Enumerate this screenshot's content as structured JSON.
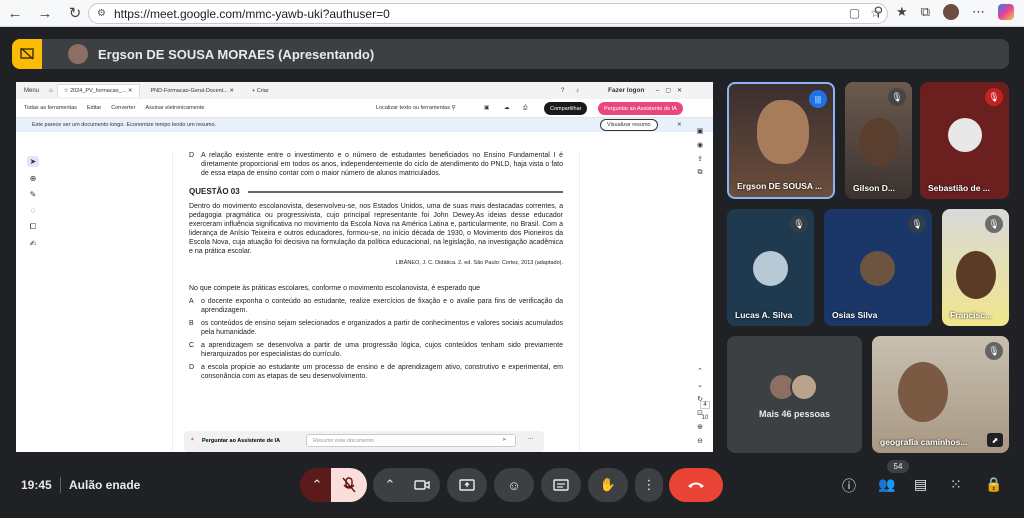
{
  "browser": {
    "url": "https://meet.google.com/mmc-yawb-uki?authuser=0"
  },
  "banner": {
    "presenter": "Ergson DE SOUSA MORAES (Apresentando)"
  },
  "pdf": {
    "menu": "Menu",
    "tab1": "2024_PV_formacao_...",
    "tab2": "PND-Formacao-Geral-Docent...",
    "new_tab": "Criar",
    "login": "Fazer logon",
    "toolbar_items": [
      "Todas as ferramentas",
      "Editar",
      "Converter",
      "Assinar eletronicamente"
    ],
    "search": "Localizar texto ou ferramentas",
    "share": "Compartilhar",
    "ai": "Perguntar ao Assistente de IA",
    "notice": "Este parece ser um documento longo. Economize tempo lendo um resumo.",
    "summary": "Visualizar resumo",
    "option_d_prev": "A relação existente entre o investimento e o número de estudantes beneficiados no Ensino Fundamental I é diretamente proporcional em todos os anos, independentemente do ciclo de atendimento do PNLD, haja vista o fato de essa etapa de ensino contar com o maior número de alunos matriculados.",
    "question_title": "QUESTÃO 03",
    "paragraph": "Dentro do movimento escolanovista, desenvolveu-se, nos Estados Unidos, uma de suas mais destacadas correntes, a pedagogia pragmática ou progressivista, cujo principal representante foi John Dewey.As ideias desse educador exerceram influência significativa no movimento da Escola Nova na América Latina e, particularmente, no Brasil. Com a liderança de Anísio Teixeira e outros educadores, formou-se, no início década de 1930, o Movimento dos Pioneiros da Escola Nova, cuja atuação foi decisiva na formulação da política educacional, na legislação, na investigação acadêmica e na prática escolar.",
    "citation": "LIBÂNEO, J. C. Didática. 2. ed. São Paulo: Cortez, 2013 (adaptado).",
    "prompt": "No que compete às práticas escolares, conforme o movimento escolanovista, é esperado que",
    "options": [
      {
        "letter": "A",
        "text": "o docente exponha o conteúdo ao estudante, realize exercícios de fixação e o avalie para fins de verificação da aprendizagem."
      },
      {
        "letter": "B",
        "text": "os conteúdos de ensino sejam selecionados e organizados a partir de conhecimentos e valores sociais acumulados pela humanidade."
      },
      {
        "letter": "C",
        "text": "a aprendizagem se desenvolva a partir de uma progressão lógica, cujos conteúdos tenham sido previamente hierarquizados por especialistas do currículo."
      },
      {
        "letter": "D",
        "text": "a escola propicie ao estudante um processo de ensino e de aprendizagem ativo, construtivo e experimental, em consonância com as etapas de seu desenvolvimento."
      }
    ],
    "letter_d": "D",
    "assist_label": "Perguntar ao Assistente de IA",
    "assist_placeholder": "Resumir este documento",
    "page_current": "4",
    "page_total": "10"
  },
  "participants": [
    {
      "name": "Ergson DE SOUSA ..."
    },
    {
      "name": "Gilson D..."
    },
    {
      "name": "Sebastião de ..."
    },
    {
      "name": "Lucas A. Silva"
    },
    {
      "name": "Osias Silva"
    },
    {
      "name": "Francisc..."
    },
    {
      "name": "geografia caminhos..."
    }
  ],
  "more_people": "Mais 46 pessoas",
  "bottom": {
    "time": "19:45",
    "meeting": "Aulão enade",
    "participant_count": "54"
  }
}
